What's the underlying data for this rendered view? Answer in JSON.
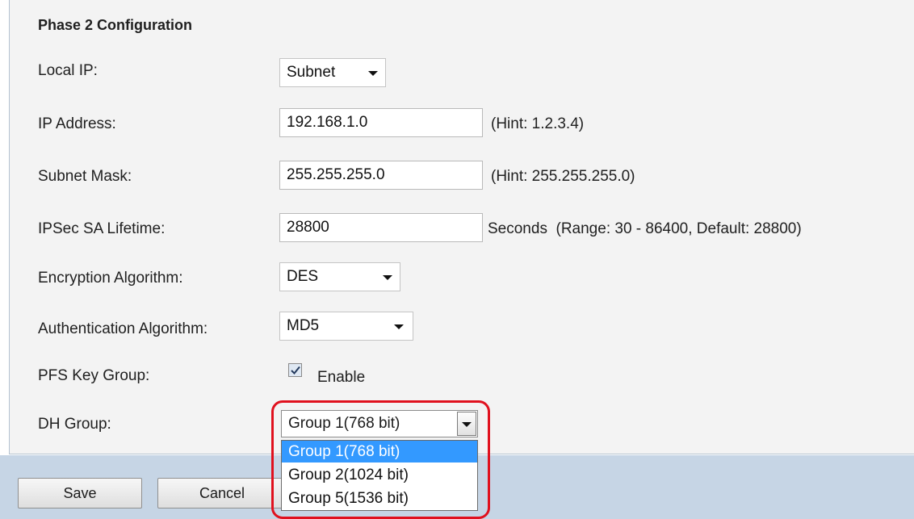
{
  "section": {
    "title": "Phase 2 Configuration"
  },
  "local_ip": {
    "label": "Local IP:",
    "value": "Subnet"
  },
  "ip_address": {
    "label": "IP Address:",
    "value": "192.168.1.0",
    "hint": "(Hint: 1.2.3.4)"
  },
  "subnet_mask": {
    "label": "Subnet Mask:",
    "value": "255.255.255.0",
    "hint": "(Hint: 255.255.255.0)"
  },
  "ipsec_lifetime": {
    "label": "IPSec SA Lifetime:",
    "value": "28800",
    "hint": "Seconds  (Range: 30 - 86400, Default: 28800)"
  },
  "encryption": {
    "label": "Encryption Algorithm:",
    "value": "DES"
  },
  "authentication": {
    "label": "Authentication Algorithm:",
    "value": "MD5"
  },
  "pfs": {
    "label": "PFS Key Group:",
    "checkbox_label": "Enable",
    "checked": true
  },
  "dh_group": {
    "label": "DH Group:",
    "value": "Group 1(768 bit)",
    "options": [
      "Group 1(768 bit)",
      "Group 2(1024 bit)",
      "Group 5(1536 bit)"
    ],
    "highlighted_index": 0
  },
  "buttons": {
    "save": "Save",
    "cancel": "Cancel"
  },
  "colors": {
    "highlight": "#e0111e",
    "selected_option": "#3399ff",
    "bottom_bar": "#c6d5e5"
  }
}
